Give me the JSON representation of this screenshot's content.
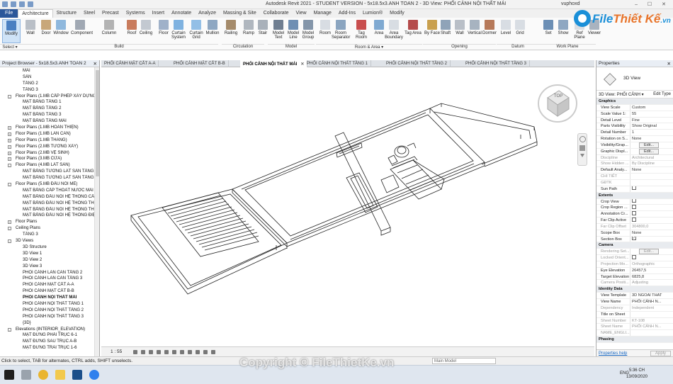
{
  "titlebar": {
    "title": "Autodesk Revit 2021 - STUDENT VERSION - 5x18.5x3.ANH TOAN 2 - 3D View: PHỐI CẢNH NỘI THẤT MÁI",
    "user": "vuphoxd"
  },
  "ribbon_tabs": [
    "File",
    "Architecture",
    "Structure",
    "Steel",
    "Precast",
    "Systems",
    "Insert",
    "Annotate",
    "Analyze",
    "Massing & Site",
    "Collaborate",
    "View",
    "Manage",
    "Add-Ins",
    "Lumion®",
    "Modify"
  ],
  "ribbon_buttons": [
    {
      "label": "Modify",
      "color": "#4a7fc1"
    },
    {
      "label": "Wall",
      "color": "#b9bfc7"
    },
    {
      "label": "Door",
      "color": "#c8a77a"
    },
    {
      "label": "Window",
      "color": "#8fb8dd"
    },
    {
      "label": "Component",
      "color": "#a0a8b3"
    },
    {
      "label": "Column",
      "color": "#b3b3b3"
    },
    {
      "label": "Roof",
      "color": "#c97c5d"
    },
    {
      "label": "Ceiling",
      "color": "#c3c9d1"
    },
    {
      "label": "Floor",
      "color": "#9fb1c9"
    },
    {
      "label": "Curtain System",
      "color": "#7fb2e0"
    },
    {
      "label": "Curtain Grid",
      "color": "#93bfe6"
    },
    {
      "label": "Mullion",
      "color": "#8ea7c2"
    },
    {
      "label": "Railing",
      "color": "#a58b6b"
    },
    {
      "label": "Ramp",
      "color": "#b0b7bf"
    },
    {
      "label": "Stair",
      "color": "#a9b1ba"
    },
    {
      "label": "Model Text",
      "color": "#6f7e91"
    },
    {
      "label": "Model Line",
      "color": "#6f8fb3"
    },
    {
      "label": "Model Group",
      "color": "#8496aa"
    },
    {
      "label": "Room",
      "color": "#d8dde3"
    },
    {
      "label": "Room Separator",
      "color": "#8ba5c0"
    },
    {
      "label": "Tag Room",
      "color": "#c94f4f"
    },
    {
      "label": "Area",
      "color": "#7fa9d1"
    },
    {
      "label": "Area Boundary",
      "color": "#d8dde3"
    },
    {
      "label": "Tag Area",
      "color": "#b54b4b"
    },
    {
      "label": "By Face",
      "color": "#c9a04e"
    },
    {
      "label": "Shaft",
      "color": "#8fa3b8"
    },
    {
      "label": "Wall",
      "color": "#b9bfc7"
    },
    {
      "label": "Vertical",
      "color": "#a7b3c0"
    },
    {
      "label": "Dormer",
      "color": "#b77a5a"
    },
    {
      "label": "Level",
      "color": "#d8dde3"
    },
    {
      "label": "Grid",
      "color": "#d8dde3"
    },
    {
      "label": "Set",
      "color": "#6c8fb5"
    },
    {
      "label": "Show",
      "color": "#8ea7c2"
    },
    {
      "label": "Ref Plane",
      "color": "#d8dde3"
    },
    {
      "label": "Viewer",
      "color": "#a9b3bf"
    }
  ],
  "ribbon_panels": [
    "Select ▾",
    "Build",
    "Circulation",
    "Model",
    "Room & Area ▾",
    "Opening",
    "Datum",
    "Work Plane"
  ],
  "logo": {
    "text": "File",
    "text2": "Thiết Kế",
    "suffix": ".vn"
  },
  "project_browser": {
    "title": "Project Browser - 5x18.5x3.ANH TOAN 2",
    "items": [
      {
        "t": "MÁI",
        "l": 2
      },
      {
        "t": "SÂN",
        "l": 2
      },
      {
        "t": "TẦNG 2",
        "l": 2
      },
      {
        "t": "TẦNG 3",
        "l": 2
      },
      {
        "t": "Floor Plans (1.MB CẤP PHÉP XÂY DỰNG)",
        "l": 1,
        "e": "-"
      },
      {
        "t": "MẶT BẰNG TẦNG 1",
        "l": 2
      },
      {
        "t": "MẶT BẰNG TẦNG 2",
        "l": 2
      },
      {
        "t": "MẶT BẰNG TẦNG 3",
        "l": 2
      },
      {
        "t": "MẶT BẰNG TẦNG MÁI",
        "l": 2
      },
      {
        "t": "Floor Plans (1.MB HOÀN THIỆN)",
        "l": 1,
        "e": "+"
      },
      {
        "t": "Floor Plans (1.MB LAN CAN)",
        "l": 1,
        "e": "+"
      },
      {
        "t": "Floor Plans (1.MB THANG)",
        "l": 1,
        "e": "+"
      },
      {
        "t": "Floor Plans (2.MB TƯỜNG XÂY)",
        "l": 1,
        "e": "+"
      },
      {
        "t": "Floor Plans (2.MB VỆ SINH)",
        "l": 1,
        "e": "+"
      },
      {
        "t": "Floor Plans (3.MB CỬA)",
        "l": 1,
        "e": "+"
      },
      {
        "t": "Floor Plans (4.MB LÁT SÀN)",
        "l": 1,
        "e": "-"
      },
      {
        "t": "MẶT BẰNG TƯỜNG LÁT SÀN TẦNG 1",
        "l": 2
      },
      {
        "t": "MẶT BẰNG TƯỜNG LÁT SÀN TẦNG 2",
        "l": 2
      },
      {
        "t": "Floor Plans (5.MB ĐẦU NỐI ME)",
        "l": 1,
        "e": "-"
      },
      {
        "t": "MẶT BẰNG CẤP THOÁT NƯỚC MÁI",
        "l": 2
      },
      {
        "t": "MẶT BẰNG ĐẦU NỐI HỆ THỐNG CẤP",
        "l": 2
      },
      {
        "t": "MẶT BẰNG ĐẦU NỐI HỆ THỐNG THO",
        "l": 2
      },
      {
        "t": "MẶT BẰNG ĐẦU NỐI HỆ THỐNG THOÁ",
        "l": 2
      },
      {
        "t": "MẶT BẰNG ĐẦU NỐI HỆ THỐNG ĐIỆN",
        "l": 2
      },
      {
        "t": "Floor Plans",
        "l": 1,
        "e": "+"
      },
      {
        "t": "Ceiling Plans",
        "l": 1,
        "e": "-"
      },
      {
        "t": "TẦNG 3",
        "l": 2
      },
      {
        "t": "3D Views",
        "l": 1,
        "e": "-"
      },
      {
        "t": "3D Structure",
        "l": 2
      },
      {
        "t": "3D View 1",
        "l": 2
      },
      {
        "t": "3D View 2",
        "l": 2
      },
      {
        "t": "3D View 3",
        "l": 2
      },
      {
        "t": "PHỐI CẢNH LAN CAN TẦNG 2",
        "l": 2
      },
      {
        "t": "PHỐI CẢNH LAN CAN TẦNG 3",
        "l": 2
      },
      {
        "t": "PHỐI CẢNH MẶT CẮT A-A",
        "l": 2
      },
      {
        "t": "PHỐI CẢNH MẶT CẮT B-B",
        "l": 2
      },
      {
        "t": "PHỐI CẢNH NỘI THẤT MÁI",
        "l": 2,
        "sel": true
      },
      {
        "t": "PHỐI CẢNH NỘI THẤT TẦNG 1",
        "l": 2
      },
      {
        "t": "PHỐI CẢNH NỘI THẤT TẦNG 2",
        "l": 2
      },
      {
        "t": "PHỐI CẢNH NỘI THẤT TẦNG 3",
        "l": 2
      },
      {
        "t": "{3D}",
        "l": 2
      },
      {
        "t": "Elevations (INTERIOR_ELEVATION)",
        "l": 1,
        "e": "-"
      },
      {
        "t": "MẶT ĐỨNG PHẢI TRỤC 6-1",
        "l": 2
      },
      {
        "t": "MẶT ĐỨNG SAU TRỤC A-B",
        "l": 2
      },
      {
        "t": "MẶT ĐỨNG TRÁI TRỤC 1-6",
        "l": 2
      }
    ]
  },
  "view_tabs": [
    {
      "t": "PHỐI CẢNH MẶT CẮT A-A"
    },
    {
      "t": "PHỐI CẢNH MẶT CẮT B-B"
    },
    {
      "t": "PHỐI CẢNH NỘI THẤT MÁI",
      "active": true
    },
    {
      "t": "PHỐI CẢNH NỘI THẤT TẦNG 1"
    },
    {
      "t": "PHỐI CẢNH NỘI THẤT TẦNG 2"
    },
    {
      "t": "PHỐI CẢNH NỘI THẤT TẦNG 3"
    }
  ],
  "viewcube_label": "TOP",
  "view_scale": "1 : 55",
  "properties": {
    "title": "Properties",
    "type_name": "3D View",
    "selector": "3D View: PHỐI CẢNH",
    "edit_type": "Edit Type",
    "rows": [
      {
        "g": "Graphics"
      },
      {
        "k": "View Scale",
        "v": "Custom"
      },
      {
        "k": "Scale Value  1:",
        "v": "55"
      },
      {
        "k": "Detail Level",
        "v": "Fine"
      },
      {
        "k": "Parts Visibility",
        "v": "Show Original"
      },
      {
        "k": "Detail Number",
        "v": "1"
      },
      {
        "k": "Rotation on S...",
        "v": "None"
      },
      {
        "k": "Visibility/Grap...",
        "b": "Edit..."
      },
      {
        "k": "Graphic Displ...",
        "b": "Edit..."
      },
      {
        "k": "Discipline",
        "v": "Architectural",
        "d": true
      },
      {
        "k": "Show Hidden ...",
        "v": "By Discipline",
        "d": true
      },
      {
        "k": "Default Analy...",
        "v": "None"
      },
      {
        "k": "CHI TIẾT",
        "v": "",
        "d": true
      },
      {
        "k": "GĐTK",
        "v": "",
        "d": true
      },
      {
        "k": "Sun Path",
        "c": ""
      },
      {
        "g": "Extents"
      },
      {
        "k": "Crop View",
        "c": ""
      },
      {
        "k": "Crop Region ...",
        "c": ""
      },
      {
        "k": "Annotation Cr...",
        "c": ""
      },
      {
        "k": "Far Clip Active",
        "c": ""
      },
      {
        "k": "Far Clip Offset",
        "v": "304800,0",
        "d": true
      },
      {
        "k": "Scope Box",
        "v": "None"
      },
      {
        "k": "Section Box",
        "c": "✓"
      },
      {
        "g": "Camera"
      },
      {
        "k": "Rendering Set...",
        "b": "Edit...",
        "d": true
      },
      {
        "k": "Locked Orient...",
        "c": "",
        "d": true
      },
      {
        "k": "Projection Mo...",
        "v": "Orthographic",
        "d": true
      },
      {
        "k": "Eye Elevation",
        "v": "26457,5"
      },
      {
        "k": "Target Elevation",
        "v": "6825,8"
      },
      {
        "k": "Camera Positi...",
        "v": "Adjusting",
        "d": true
      },
      {
        "g": "Identity Data"
      },
      {
        "k": "View Template",
        "v": "3D NGOAI THAT"
      },
      {
        "k": "View Name",
        "v": "PHỐI CẢNH N..."
      },
      {
        "k": "Dependency",
        "v": "Independent",
        "d": true
      },
      {
        "k": "Title on Sheet",
        "v": ""
      },
      {
        "k": "Sheet Number",
        "v": "KT-108",
        "d": true
      },
      {
        "k": "Sheet Name",
        "v": "PHỐI CẢNH N...",
        "d": true
      },
      {
        "k": "NAME_ENGLI...",
        "v": "",
        "d": true
      },
      {
        "g": "Phasing"
      }
    ],
    "help": "Properties help",
    "apply": "Apply"
  },
  "status": {
    "text": "Click to select, TAB for alternates, CTRL adds, SHIFT unselects.",
    "model": "Main Model"
  },
  "taskbar": {
    "lang": "ENG",
    "time": "5:36 CH",
    "date": "13/09/2020"
  },
  "watermark": "Copyright © FileThietKe.vn"
}
